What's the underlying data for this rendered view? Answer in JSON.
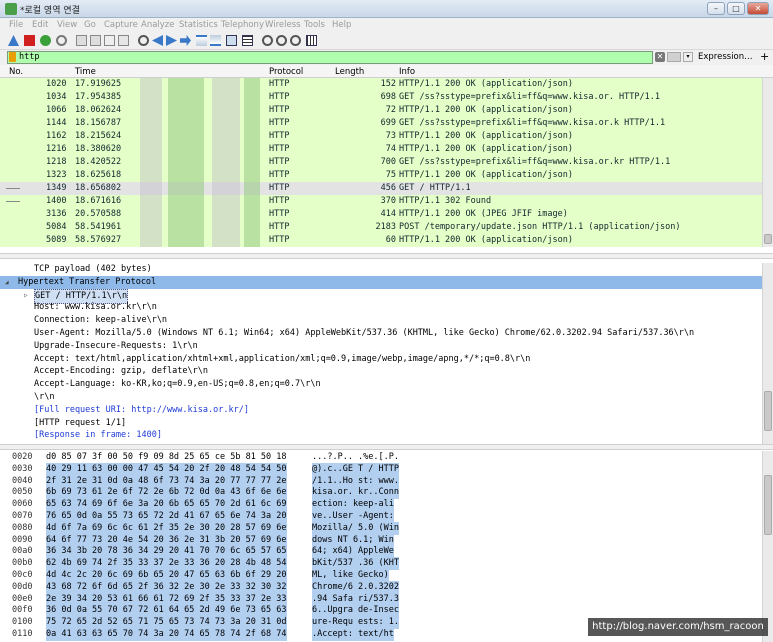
{
  "window": {
    "title": "*로컬 영역 연결",
    "min": "–",
    "max": "□",
    "close": "✕"
  },
  "menu": [
    "File",
    "Edit",
    "View",
    "Go",
    "Capture",
    "Analyze",
    "Statistics",
    "Telephony",
    "Wireless",
    "Tools",
    "Help"
  ],
  "filter": {
    "value": "http",
    "expression_label": "Expression…",
    "clear": "✕",
    "dropdown": "▾",
    "add": "+"
  },
  "columns": {
    "no": "No.",
    "time": "Time",
    "protocol": "Protocol",
    "length": "Length",
    "info": "Info"
  },
  "packets": [
    {
      "no": "1020",
      "time": "17.919625",
      "protocol": "HTTP",
      "length": "152",
      "info": "HTTP/1.1 200 OK  (application/json)"
    },
    {
      "no": "1034",
      "time": "17.954385",
      "protocol": "HTTP",
      "length": "698",
      "info": "GET /ss?sstype=prefix&li=ff&q=www.kisa.or. HTTP/1.1"
    },
    {
      "no": "1066",
      "time": "18.062624",
      "protocol": "HTTP",
      "length": "72",
      "info": "HTTP/1.1 200 OK  (application/json)"
    },
    {
      "no": "1144",
      "time": "18.156787",
      "protocol": "HTTP",
      "length": "699",
      "info": "GET /ss?sstype=prefix&li=ff&q=www.kisa.or.k HTTP/1.1"
    },
    {
      "no": "1162",
      "time": "18.215624",
      "protocol": "HTTP",
      "length": "73",
      "info": "HTTP/1.1 200 OK  (application/json)"
    },
    {
      "no": "1216",
      "time": "18.380620",
      "protocol": "HTTP",
      "length": "74",
      "info": "HTTP/1.1 200 OK  (application/json)"
    },
    {
      "no": "1218",
      "time": "18.420522",
      "protocol": "HTTP",
      "length": "700",
      "info": "GET /ss?sstype=prefix&li=ff&q=www.kisa.or.kr HTTP/1.1"
    },
    {
      "no": "1323",
      "time": "18.625618",
      "protocol": "HTTP",
      "length": "75",
      "info": "HTTP/1.1 200 OK  (application/json)"
    },
    {
      "no": "1349",
      "time": "18.656802",
      "protocol": "HTTP",
      "length": "456",
      "info": "GET / HTTP/1.1",
      "selected": true
    },
    {
      "no": "1400",
      "time": "18.671616",
      "protocol": "HTTP",
      "length": "370",
      "info": "HTTP/1.1 302 Found"
    },
    {
      "no": "3136",
      "time": "20.570588",
      "protocol": "HTTP",
      "length": "414",
      "info": "HTTP/1.1 200 OK  (JPEG JFIF image)"
    },
    {
      "no": "5084",
      "time": "58.541961",
      "protocol": "HTTP",
      "length": "2183",
      "info": "POST /temporary/update.json HTTP/1.1  (application/json)"
    },
    {
      "no": "5089",
      "time": "58.576927",
      "protocol": "HTTP",
      "length": "60",
      "info": "HTTP/1.1 200 OK  (application/json)"
    }
  ],
  "details": [
    {
      "indent": 2,
      "text": "TCP payload (402 bytes)"
    },
    {
      "indent": 0,
      "text": "Hypertext Transfer Protocol",
      "expander": "◢",
      "highlight": true
    },
    {
      "indent": 2,
      "text": "GET / HTTP/1.1\\r\\n",
      "expander": "▷"
    },
    {
      "indent": 2,
      "text": "Host: www.kisa.or.kr\\r\\n"
    },
    {
      "indent": 2,
      "text": "Connection: keep-alive\\r\\n"
    },
    {
      "indent": 2,
      "text": "User-Agent: Mozilla/5.0 (Windows NT 6.1; Win64; x64) AppleWebKit/537.36 (KHTML, like Gecko) Chrome/62.0.3202.94 Safari/537.36\\r\\n"
    },
    {
      "indent": 2,
      "text": "Upgrade-Insecure-Requests: 1\\r\\n"
    },
    {
      "indent": 2,
      "text": "Accept: text/html,application/xhtml+xml,application/xml;q=0.9,image/webp,image/apng,*/*;q=0.8\\r\\n"
    },
    {
      "indent": 2,
      "text": "Accept-Encoding: gzip, deflate\\r\\n"
    },
    {
      "indent": 2,
      "text": "Accept-Language: ko-KR,ko;q=0.9,en-US;q=0.8,en;q=0.7\\r\\n"
    },
    {
      "indent": 2,
      "text": "\\r\\n"
    },
    {
      "indent": 2,
      "text": "[Full request URI: http://www.kisa.or.kr/]",
      "link": true
    },
    {
      "indent": 2,
      "text": "[HTTP request 1/1]"
    },
    {
      "indent": 2,
      "text": "[Response in frame: 1400]",
      "link": true
    }
  ],
  "bytes": [
    {
      "off": "0020",
      "hex": "d0 85 07 3f 00 50 f9 09  8d 25 65 ce 5b 81 50 18",
      "ascii": "...?.P.. .%e.[.P."
    },
    {
      "off": "0030",
      "hex": "40 29 11 63 00 00 47 45  54 20 2f 20 48 54 54 50",
      "ascii": "@).c..GE T / HTTP",
      "hlfrom": 6
    },
    {
      "off": "0040",
      "hex": "2f 31 2e 31 0d 0a 48 6f  73 74 3a 20 77 77 77 2e",
      "ascii": "/1.1..Ho st: www."
    },
    {
      "off": "0050",
      "hex": "6b 69 73 61 2e 6f 72 2e  6b 72 0d 0a 43 6f 6e 6e",
      "ascii": "kisa.or. kr..Conn"
    },
    {
      "off": "0060",
      "hex": "65 63 74 69 6f 6e 3a 20  6b 65 65 70 2d 61 6c 69",
      "ascii": "ection:  keep-ali"
    },
    {
      "off": "0070",
      "hex": "76 65 0d 0a 55 73 65 72  2d 41 67 65 6e 74 3a 20",
      "ascii": "ve..User -Agent: "
    },
    {
      "off": "0080",
      "hex": "4d 6f 7a 69 6c 6c 61 2f  35 2e 30 20 28 57 69 6e",
      "ascii": "Mozilla/ 5.0 (Win"
    },
    {
      "off": "0090",
      "hex": "64 6f 77 73 20 4e 54 20  36 2e 31 3b 20 57 69 6e",
      "ascii": "dows NT  6.1; Win"
    },
    {
      "off": "00a0",
      "hex": "36 34 3b 20 78 36 34 29  20 41 70 70 6c 65 57 65",
      "ascii": "64; x64)  AppleWe"
    },
    {
      "off": "00b0",
      "hex": "62 4b 69 74 2f 35 33 37  2e 33 36 20 28 4b 48 54",
      "ascii": "bKit/537 .36 (KHT"
    },
    {
      "off": "00c0",
      "hex": "4d 4c 2c 20 6c 69 6b 65  20 47 65 63 6b 6f 29 20",
      "ascii": "ML, like  Gecko) "
    },
    {
      "off": "00d0",
      "hex": "43 68 72 6f 6d 65 2f 36  32 2e 30 2e 33 32 30 32",
      "ascii": "Chrome/6 2.0.3202"
    },
    {
      "off": "00e0",
      "hex": "2e 39 34 20 53 61 66 61  72 69 2f 35 33 37 2e 33",
      "ascii": ".94 Safa ri/537.3"
    },
    {
      "off": "00f0",
      "hex": "36 0d 0a 55 70 67 72 61  64 65 2d 49 6e 73 65 63",
      "ascii": "6..Upgra de-Insec"
    },
    {
      "off": "0100",
      "hex": "75 72 65 2d 52 65 71 75  65 73 74 73 3a 20 31 0d",
      "ascii": "ure-Requ ests: 1."
    },
    {
      "off": "0110",
      "hex": "0a 41 63 63 65 70 74 3a  20 74 65 78 74 2f 68 74",
      "ascii": ".Accept:  text/ht"
    }
  ],
  "watermark": "http://blog.naver.com/hsm_racoon",
  "colors": {
    "http_row": "#e4ffc7",
    "selected_row": "#e3e3e3",
    "filter_ok": "#afffaf",
    "highlight": "#8fb9e8"
  }
}
